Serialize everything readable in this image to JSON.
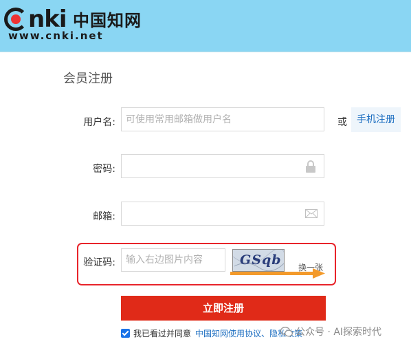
{
  "header": {
    "logo_latin": "nki",
    "logo_chinese": "中国知网",
    "logo_url": "www.cnki.net"
  },
  "page": {
    "title": "会员注册"
  },
  "form": {
    "username": {
      "label": "用户名:",
      "placeholder": "可使用常用邮箱做用户名",
      "value": ""
    },
    "password": {
      "label": "密码:",
      "value": ""
    },
    "email": {
      "label": "邮箱:",
      "value": ""
    },
    "captcha": {
      "label": "验证码:",
      "placeholder": "输入右边图片内容",
      "image_text": "GSqb",
      "refresh_label": "换一张"
    },
    "or_text": "或",
    "phone_register_label": "手机注册",
    "submit_label": "立即注册",
    "agree_prefix": "我已看过并同意",
    "agree_link": "中国知网使用协议、隐私政策",
    "agree_checked": true
  },
  "watermark": {
    "text": "公众号 · AI探索时代"
  },
  "colors": {
    "header_bg": "#8ad6f3",
    "submit_bg": "#e02a18",
    "link": "#1e6fc1",
    "highlight_box": "#e8232a",
    "arrow": "#f39a2b"
  },
  "icons": {
    "password_field": "lock-icon",
    "email_field": "envelope-icon",
    "watermark": "wechat-icon"
  }
}
